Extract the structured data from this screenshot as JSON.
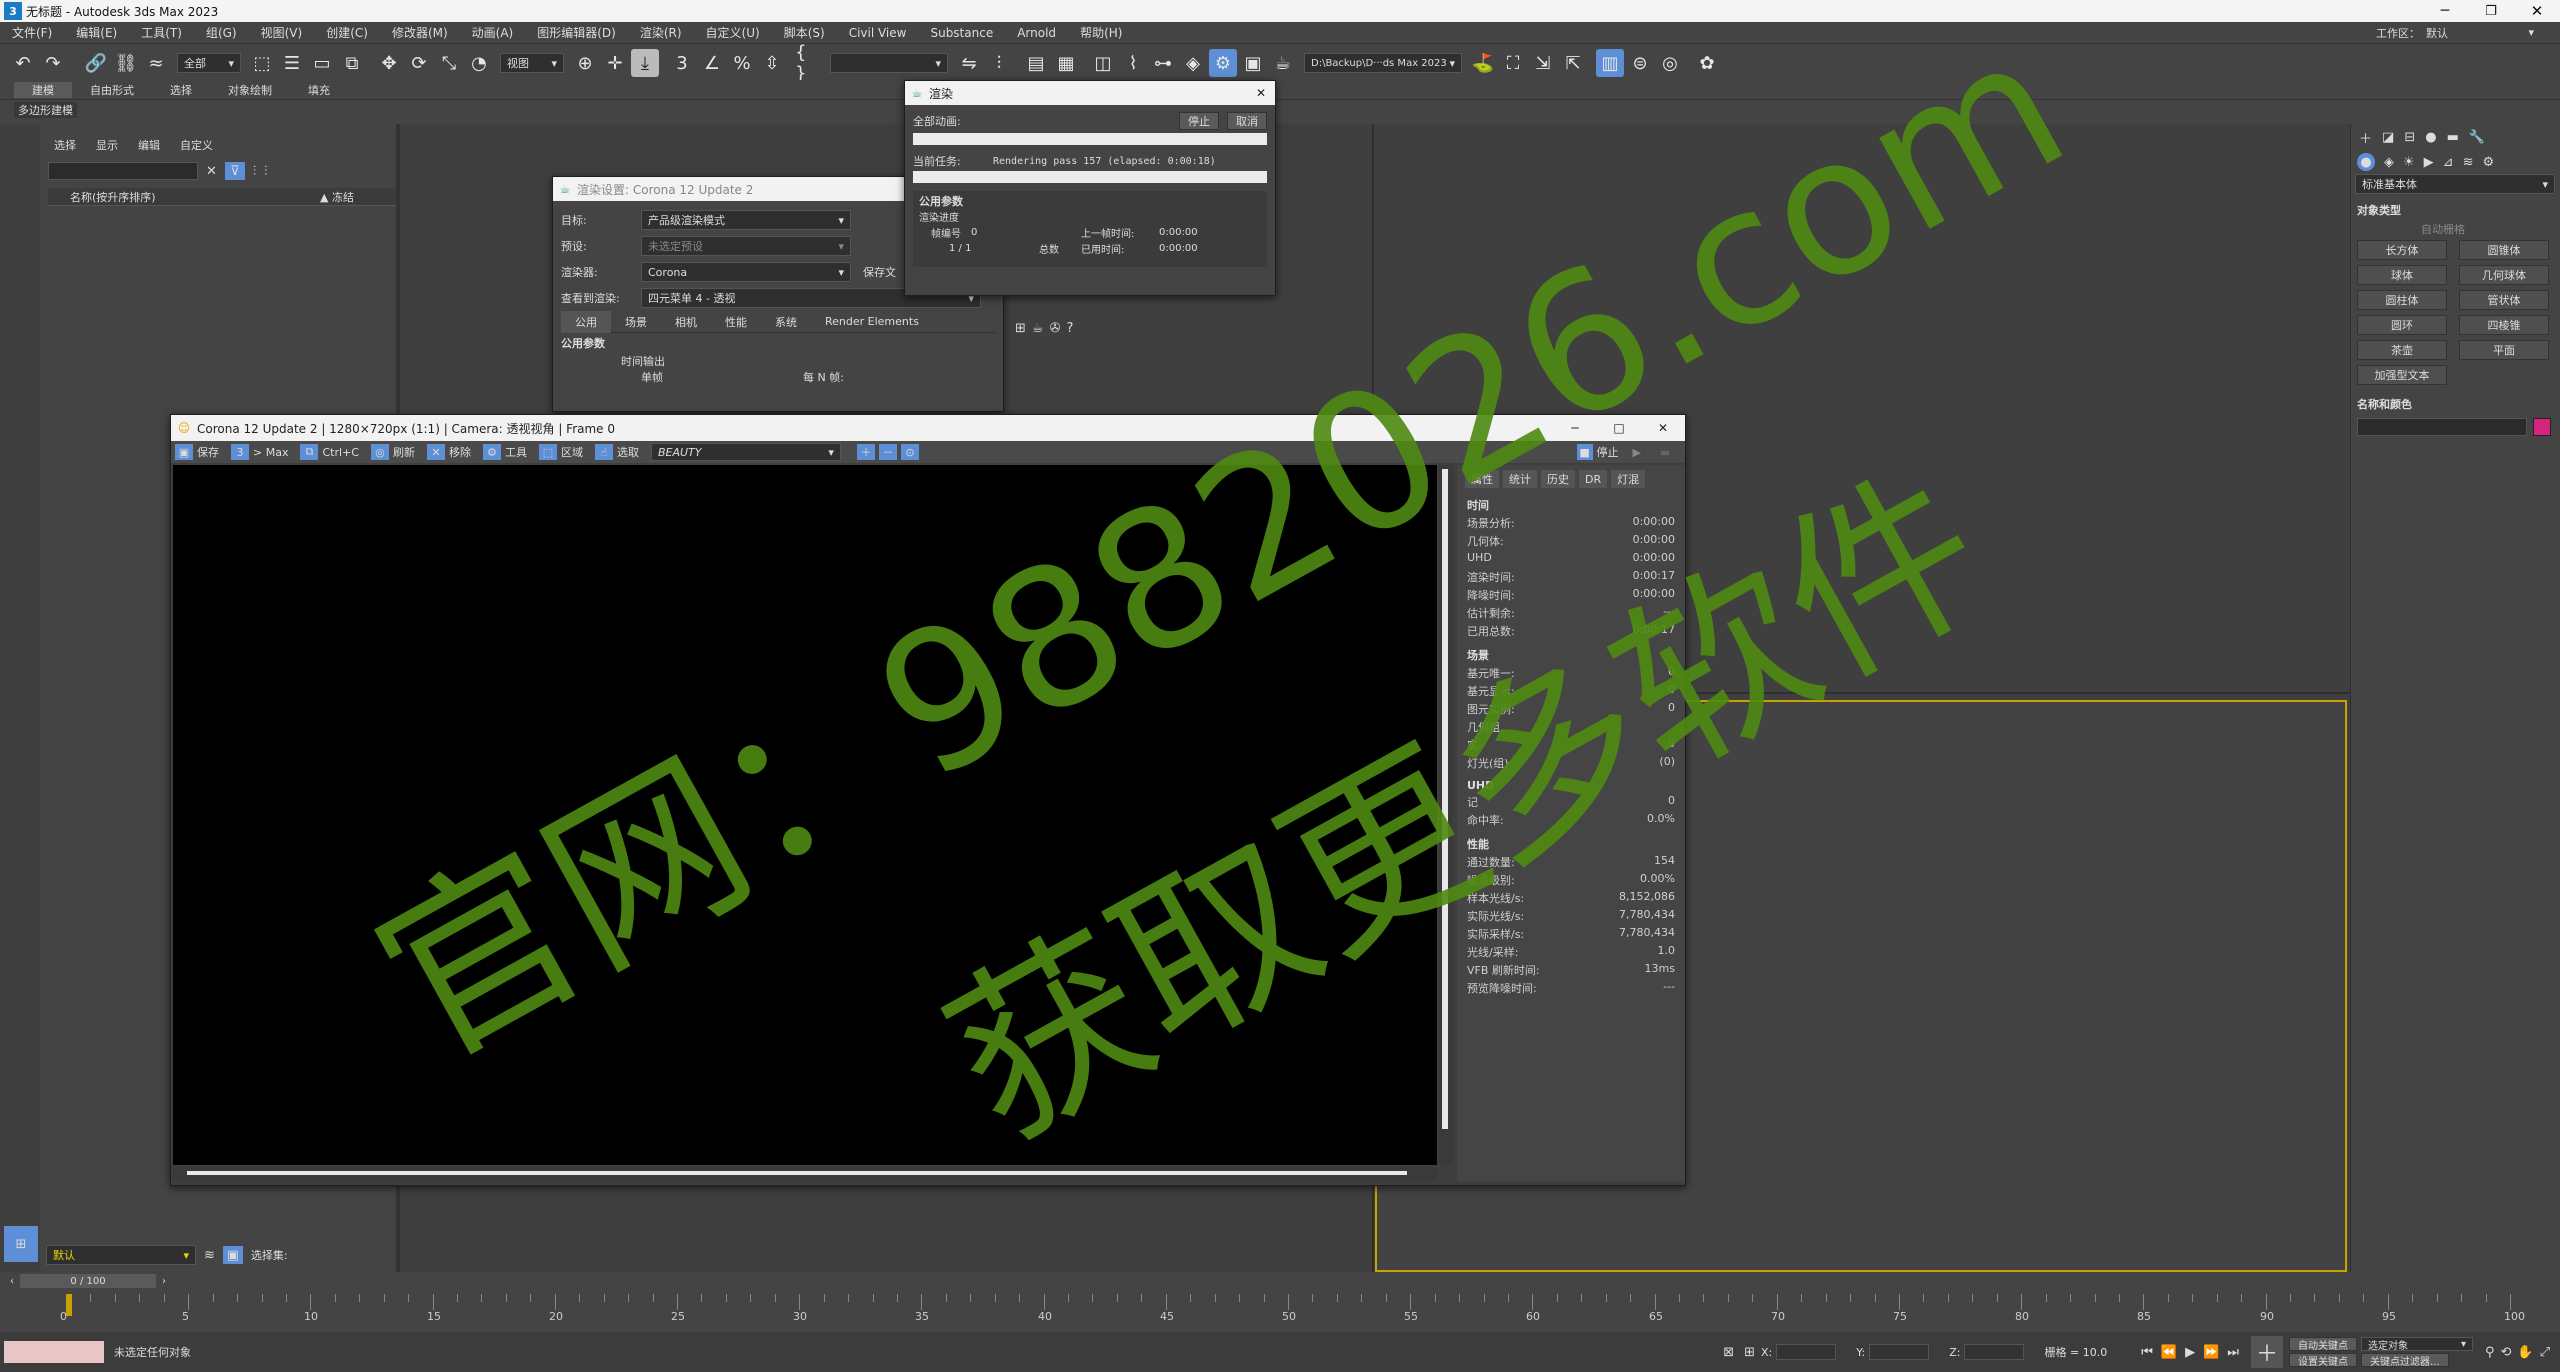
{
  "app": {
    "title": "无标题 - Autodesk 3ds Max 2023",
    "workspace_label": "工作区：",
    "workspace_value": "默认"
  },
  "menu": [
    "文件(F)",
    "编辑(E)",
    "工具(T)",
    "组(G)",
    "视图(V)",
    "创建(C)",
    "修改器(M)",
    "动画(A)",
    "图形编辑器(D)",
    "渲染(R)",
    "自定义(U)",
    "脚本(S)",
    "Civil View",
    "Substance",
    "Arnold",
    "帮助(H)"
  ],
  "toolbar": {
    "selection_filter": "全部",
    "ref_coord": "视图",
    "named_sel": "",
    "project_path": "D:\\Backup\\D···ds Max 2023"
  },
  "ribbon": {
    "tabs": [
      "建模",
      "自由形式",
      "选择",
      "对象绘制",
      "填充"
    ],
    "sub": "多边形建模"
  },
  "scene_explorer": {
    "tabs": [
      "选择",
      "显示",
      "编辑",
      "自定义"
    ],
    "col_name": "名称(按升序排序)",
    "col_frozen": "▲ 冻结",
    "layer": "默认",
    "selection_set_label": "选择集:"
  },
  "render_progress": {
    "title": "渲染",
    "all_anim": "全部动画:",
    "stop": "停止",
    "cancel": "取消",
    "current_task_label": "当前任务:",
    "current_task": "Rendering pass 157 (elapsed: 0:00:18)",
    "common_params": "公用参数",
    "progress_label": "渲染进度",
    "frame_no_label": "帧编号",
    "frame_no": "0",
    "frames_count": "1 / 1",
    "total_label": "总数",
    "last_frame_label": "上一帧时间:",
    "last_frame": "0:00:00",
    "elapsed_label": "已用时间:",
    "elapsed": "0:00:00"
  },
  "render_setup": {
    "title": "渲染设置: Corona 12 Update 2",
    "target_label": "目标:",
    "target": "产品级渲染模式",
    "preset_label": "预设:",
    "preset": "未选定预设",
    "renderer_label": "渲染器:",
    "renderer": "Corona",
    "save_file": "保存文",
    "view_label": "查看到渲染:",
    "view": "四元菜单 4 - 透视",
    "tabs": [
      "公用",
      "场景",
      "相机",
      "性能",
      "系统",
      "Render Elements"
    ],
    "section": "公用参数",
    "time_output": "时间输出",
    "single": "单帧",
    "every_n": "每 N 帧:"
  },
  "vfb": {
    "title": "Corona 12 Update 2 | 1280×720px (1:1) | Camera: 透视视角 | Frame 0",
    "tools": {
      "save": "保存",
      "to_max": "> Max",
      "copy": "Ctrl+C",
      "refresh": "刷新",
      "remove": "移除",
      "tools": "工具",
      "region": "区域",
      "pick": "选取"
    },
    "pass": "BEAUTY",
    "stop": "停止",
    "side_tabs": [
      "属性",
      "统计",
      "历史",
      "DR",
      "灯混"
    ],
    "time_section": "时间",
    "time_stats": [
      {
        "k": "场景分析:",
        "v": "0:00:00"
      },
      {
        "k": "几何体:",
        "v": "0:00:00"
      },
      {
        "k": "UHD",
        "v": "0:00:00"
      },
      {
        "k": "渲染时间:",
        "v": "0:00:17"
      },
      {
        "k": "降噪时间:",
        "v": "0:00:00"
      },
      {
        "k": "估计剩余:",
        "v": "---"
      },
      {
        "k": "已用总数:",
        "v": "0:00:17"
      }
    ],
    "scene_section": "场景",
    "scene_stats": [
      {
        "k": "基元唯一:",
        "v": "0"
      },
      {
        "k": "基元显示:",
        "v": "0"
      },
      {
        "k": "图元实例:",
        "v": "0"
      },
      {
        "k": "几何组",
        "v": ""
      },
      {
        "k": "实",
        "v": "0"
      },
      {
        "k": "灯光(组):",
        "v": "(0)"
      }
    ],
    "uhd_section": "UHD",
    "uhd_stats": [
      {
        "k": "记",
        "v": "0"
      },
      {
        "k": "命中率:",
        "v": "0.0%"
      }
    ],
    "perf_section": "性能",
    "perf_stats": [
      {
        "k": "通过数量:",
        "v": "154"
      },
      {
        "k": "噪点级别:",
        "v": "0.00%"
      },
      {
        "k": "样本光线/s:",
        "v": "8,152,086"
      },
      {
        "k": "实际光线/s:",
        "v": "7,780,434"
      },
      {
        "k": "实际采样/s:",
        "v": "7,780,434"
      },
      {
        "k": "光线/采样:",
        "v": "1.0"
      },
      {
        "k": "VFB 刷新时间:",
        "v": "13ms"
      },
      {
        "k": "预览降噪时间:",
        "v": "---"
      }
    ]
  },
  "command_panel": {
    "dropdown": "标准基本体",
    "section_obj": "对象类型",
    "autogrid": "自动栅格",
    "buttons": [
      "长方体",
      "圆锥体",
      "球体",
      "几何球体",
      "圆柱体",
      "管状体",
      "圆环",
      "四棱锥",
      "茶壶",
      "平面"
    ],
    "extra_button": "加强型文本",
    "section_name": "名称和颜色",
    "color": "#d4247c"
  },
  "timeline": {
    "frame": "0 / 100",
    "ticks": [
      "0",
      "5",
      "10",
      "15",
      "20",
      "25",
      "30",
      "35",
      "40",
      "45",
      "50",
      "55",
      "60",
      "65",
      "70",
      "75",
      "80",
      "85",
      "90",
      "95",
      "100"
    ]
  },
  "status": {
    "message": "未选定任何对象",
    "x_label": "X:",
    "y_label": "Y:",
    "z_label": "Z:",
    "grid": "栅格 = 10.0",
    "autokey": "自动关键点",
    "selected": "选定对象",
    "set_key": "设置关键点",
    "key_filter": "关键点过滤器..."
  },
  "watermark": {
    "line1": "官网：9882026.com",
    "line2": "获取更多软件",
    "color": "#4f8a12"
  }
}
